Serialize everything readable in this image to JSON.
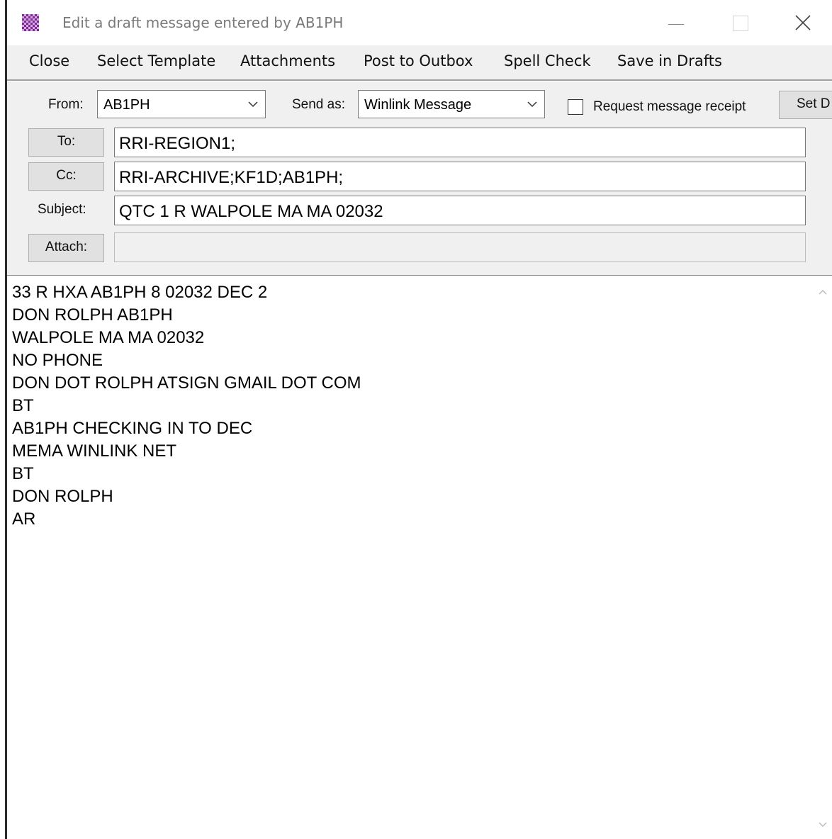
{
  "window": {
    "title": "Edit a draft message entered by AB1PH"
  },
  "menu": {
    "items": [
      "Close",
      "Select Template",
      "Attachments",
      "Post to Outbox",
      "Spell Check",
      "Save in Drafts"
    ]
  },
  "header": {
    "from_label": "From:",
    "from_value": "AB1PH",
    "send_as_label": "Send as:",
    "send_as_value": "Winlink Message",
    "receipt_label": "Request message receipt",
    "receipt_checked": false,
    "set_button_label": "Set D",
    "to_button": "To:",
    "to_value": "RRI-REGION1;",
    "cc_button": "Cc:",
    "cc_value": "RRI-ARCHIVE;KF1D;AB1PH;",
    "subject_label": "Subject:",
    "subject_value": "QTC 1 R WALPOLE MA MA 02032",
    "attach_button": "Attach:",
    "attach_value": ""
  },
  "message_body": {
    "lines": [
      "33 R HXA AB1PH 8 02032 DEC 2",
      "DON ROLPH AB1PH",
      "WALPOLE MA MA 02032",
      "NO PHONE",
      "DON DOT ROLPH ATSIGN GMAIL DOT COM",
      "BT",
      "AB1PH CHECKING IN TO DEC",
      "MEMA WINLINK NET",
      "BT",
      "DON ROLPH",
      "AR"
    ]
  },
  "icons": {
    "app": "winlink-checkerboard-icon",
    "minimize": "minimize-icon",
    "maximize": "maximize-icon",
    "close": "close-icon",
    "dropdown": "chevron-down-icon"
  },
  "colors": {
    "app_icon_primary": "#7b2d8e",
    "app_icon_secondary": "#d9a6e6",
    "window_bg": "#f0f0f0"
  }
}
